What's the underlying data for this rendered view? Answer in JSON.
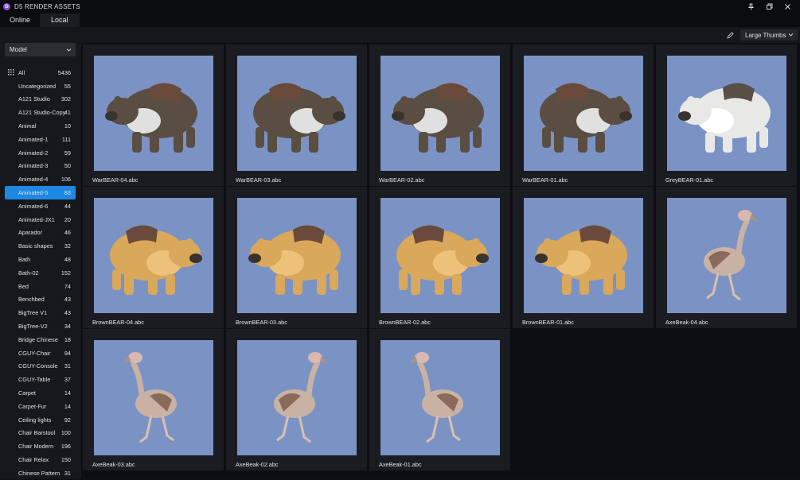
{
  "app": {
    "title": "D5 RENDER ASSETS",
    "logo_letter": "D"
  },
  "tabs": [
    {
      "label": "Online"
    },
    {
      "label": "Local"
    }
  ],
  "toolbar": {
    "view_mode": "Large Thumbs"
  },
  "sidebar": {
    "filter": "Model",
    "categories": [
      {
        "name": "All",
        "count": "5436"
      },
      {
        "name": "Uncategorized",
        "count": "55"
      },
      {
        "name": "A121 Studio",
        "count": "302"
      },
      {
        "name": "A121 Studio-Copy",
        "count": "41"
      },
      {
        "name": "Animal",
        "count": "10"
      },
      {
        "name": "Animated-1",
        "count": "111"
      },
      {
        "name": "Animated-2",
        "count": "59"
      },
      {
        "name": "Animated-3",
        "count": "50"
      },
      {
        "name": "Animated-4",
        "count": "106"
      },
      {
        "name": "Animated-5",
        "count": "83"
      },
      {
        "name": "Animated-6",
        "count": "44"
      },
      {
        "name": "Animated-JX1",
        "count": "20"
      },
      {
        "name": "Aparador",
        "count": "46"
      },
      {
        "name": "Basic shapes",
        "count": "32"
      },
      {
        "name": "Bath",
        "count": "48"
      },
      {
        "name": "Bath-02",
        "count": "152"
      },
      {
        "name": "Bed",
        "count": "74"
      },
      {
        "name": "Benchbed",
        "count": "43"
      },
      {
        "name": "BigTree V1",
        "count": "43"
      },
      {
        "name": "BigTree-V2",
        "count": "34"
      },
      {
        "name": "Bridge Chinese",
        "count": "18"
      },
      {
        "name": "CGUY-Chair",
        "count": "94"
      },
      {
        "name": "CGUY-Console",
        "count": "31"
      },
      {
        "name": "CGUY-Table",
        "count": "37"
      },
      {
        "name": "Carpet",
        "count": "14"
      },
      {
        "name": "Carpet-Fur",
        "count": "14"
      },
      {
        "name": "Ceiling lights",
        "count": "92"
      },
      {
        "name": "Chair Barstool",
        "count": "100"
      },
      {
        "name": "Chair Modern",
        "count": "196"
      },
      {
        "name": "Chair Relax",
        "count": "150"
      },
      {
        "name": "Chinese Pattern",
        "count": "31"
      }
    ]
  },
  "assets": [
    {
      "name": "WarBEAR-04.abc",
      "kind": "warbear"
    },
    {
      "name": "WarBEAR-03.abc",
      "kind": "warbear"
    },
    {
      "name": "WarBEAR-02.abc",
      "kind": "warbear"
    },
    {
      "name": "WarBEAR-01.abc",
      "kind": "warbear"
    },
    {
      "name": "GreyBEAR-01.abc",
      "kind": "greybear"
    },
    {
      "name": "BrownBEAR-04.abc",
      "kind": "brownbear"
    },
    {
      "name": "BrownBEAR-03.abc",
      "kind": "brownbear"
    },
    {
      "name": "BrownBEAR-02.abc",
      "kind": "brownbear"
    },
    {
      "name": "BrownBEAR-01.abc",
      "kind": "brownbear"
    },
    {
      "name": "AxeBeak-04.abc",
      "kind": "axebeak"
    },
    {
      "name": "AxeBeak-03.abc",
      "kind": "axebeak"
    },
    {
      "name": "AxeBeak-02.abc",
      "kind": "axebeak"
    },
    {
      "name": "AxeBeak-01.abc",
      "kind": "axebeak"
    }
  ],
  "colors": {
    "accent": "#1e88e5",
    "thumb_bg": "#7b93c4",
    "warbear": "#5a4e42",
    "greybear": "#e8e8e6",
    "brownbear": "#d9a85a",
    "axebeak": "#c9b2a4"
  }
}
